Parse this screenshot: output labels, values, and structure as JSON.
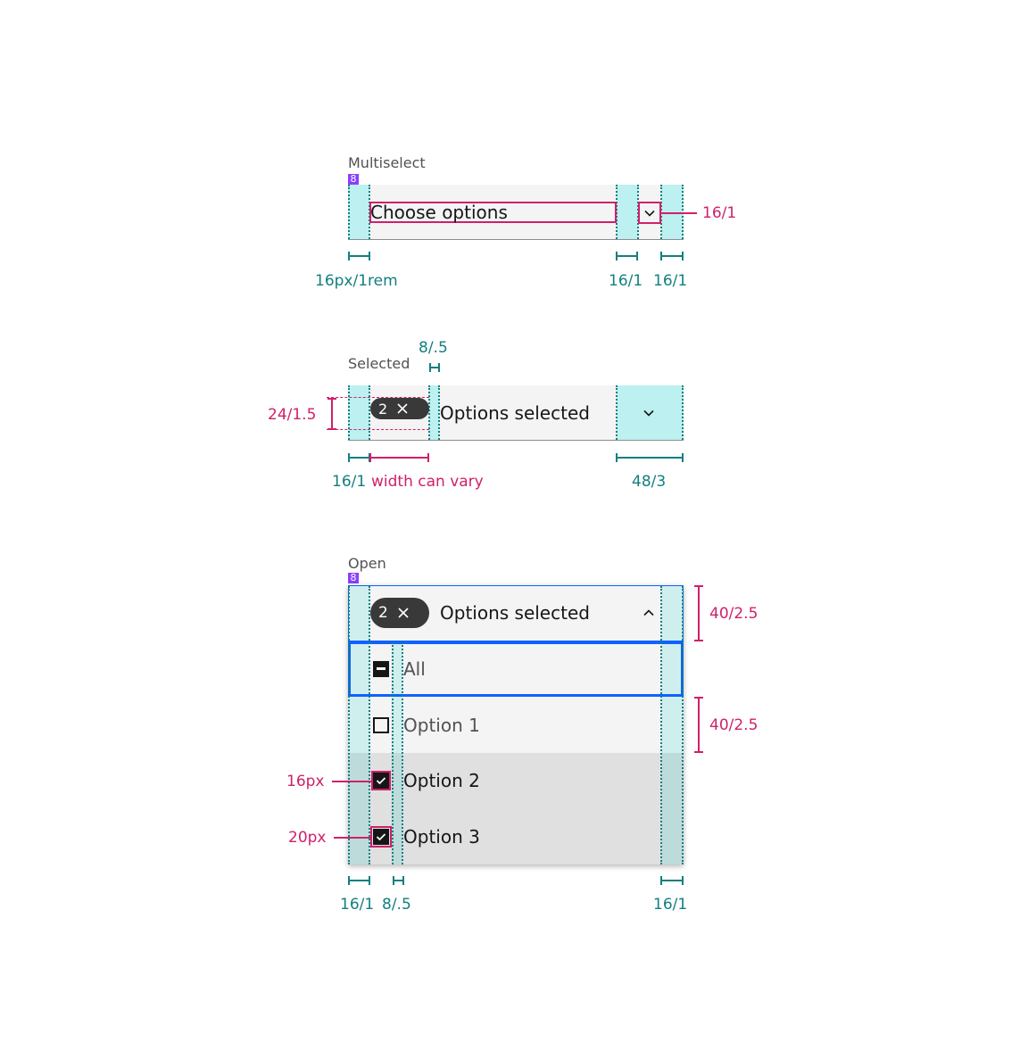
{
  "sections": {
    "multiselect": {
      "label": "Multiselect",
      "grid_badge": "8",
      "placeholder": "Choose options",
      "annotations": {
        "left_padding": "16px/1rem",
        "gap_before_icon": "16/1",
        "icon_right_padding": "16/1",
        "icon_size": "16/1"
      }
    },
    "selected": {
      "label": "Selected",
      "tag_count": "2",
      "text": "Options selected",
      "annotations": {
        "tag_gap": "8/.5",
        "tag_height": "24/1.5",
        "left_padding": "16/1",
        "tag_width": "width can vary",
        "icon_area": "48/3"
      }
    },
    "open": {
      "label": "Open",
      "grid_badge": "8",
      "tag_count": "2",
      "text": "Options selected",
      "items": [
        {
          "label": "All",
          "state": "indeterminate",
          "focused": true,
          "hovered": false
        },
        {
          "label": "Option 1",
          "state": "unchecked",
          "focused": false,
          "hovered": false
        },
        {
          "label": "Option 2",
          "state": "checked",
          "focused": false,
          "hovered": true
        },
        {
          "label": "Option 3",
          "state": "checked",
          "focused": false,
          "hovered": true
        }
      ],
      "annotations": {
        "field_height": "40/2.5",
        "item_height": "40/2.5",
        "checkbox_16": "16px",
        "checkbox_20": "20px",
        "left_padding": "16/1",
        "checkbox_gap": "8/.5",
        "right_padding": "16/1"
      }
    }
  },
  "icons": {
    "close": "✕",
    "chevron_down": "chevron-down",
    "chevron_up": "chevron-up",
    "checkmark": "✓"
  },
  "colors": {
    "teal": "#127f7f",
    "pink": "#d0206a",
    "focus_blue": "#0f62fe",
    "field_bg": "#f4f4f4",
    "tag_bg": "#393939",
    "grid_badge": "#8a3ffc"
  }
}
